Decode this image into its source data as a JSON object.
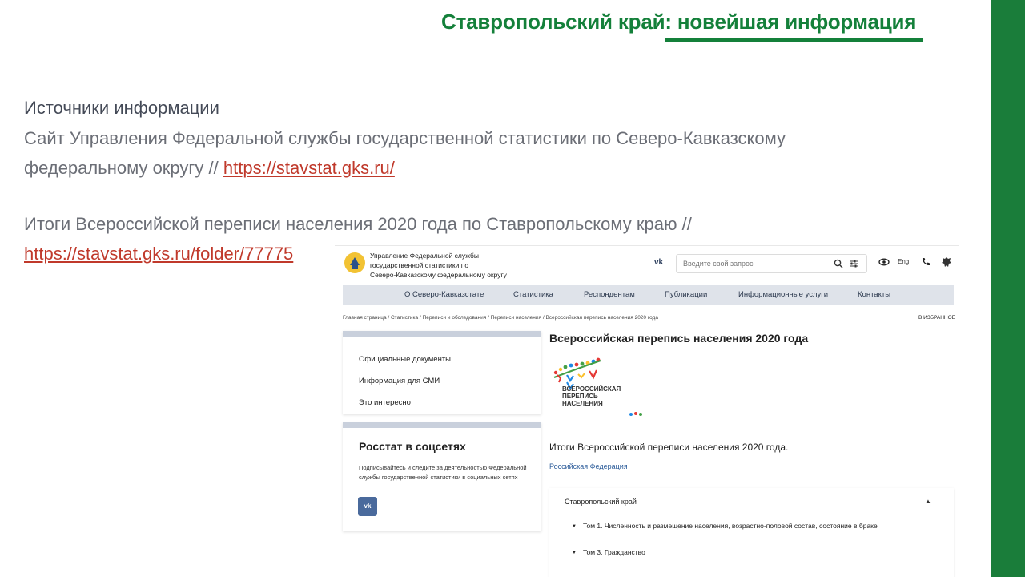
{
  "slide": {
    "title": "Ставропольский край: новейшая информация",
    "sources_heading": "Источники информации",
    "para1_line1": "Сайт Управления Федеральной службы государственной статистики по Северо-Кавказскому",
    "para1_line2_prefix": "федеральному округу // ",
    "para1_link": "https://stavstat.gks.ru/",
    "para2_line1": "Итоги Всероссийской переписи населения 2020 года по Ставропольскому краю //",
    "para2_link": "https://stavstat.gks.ru/folder/77775",
    "colors": {
      "accent_green": "#14803a",
      "link_red": "#c0392b",
      "sidebar_green": "#1a7d3a"
    }
  },
  "site": {
    "org_line1": "Управление Федеральной службы",
    "org_line2": "государственной статистики по",
    "org_line3": "Северо-Кавказскому федеральному округу",
    "vk_label": "vk",
    "search_placeholder": "Введите свой запрос",
    "lang": "Eng",
    "nav": [
      "О Северо-Кавказстате",
      "Статистика",
      "Респондентам",
      "Публикации",
      "Информационные услуги",
      "Контакты"
    ],
    "breadcrumb": "Главная страница / Статистика / Переписи и обследования / Переписи населения / Всероссийская перепись населения 2020 года",
    "favorites": "В ИЗБРАННОЕ",
    "side_links": [
      "Официальные документы",
      "Информация для СМИ",
      "Это интересно"
    ],
    "social_title": "Росстат в соцсетях",
    "social_desc": "Подписывайтесь и следите за деятельностью Федеральной службы государственной статистики в социальных сетях",
    "vk_button": "vk",
    "census_title": "Всероссийская перепись населения 2020 года",
    "logo_line1": "ВСЕРОССИЙСКАЯ",
    "logo_line2": "ПЕРЕПИСЬ",
    "logo_line3": "НАСЕЛЕНИЯ",
    "results_text": "Итоги Всероссийской переписи населения 2020 года.",
    "rf_link": "Российская Федерация",
    "accordion_head": "Ставропольский край",
    "accordion_items": [
      "Том 1. Численность и размещение населения, возрастно-половой состав, состояние в браке",
      "Том 3. Гражданство"
    ]
  }
}
